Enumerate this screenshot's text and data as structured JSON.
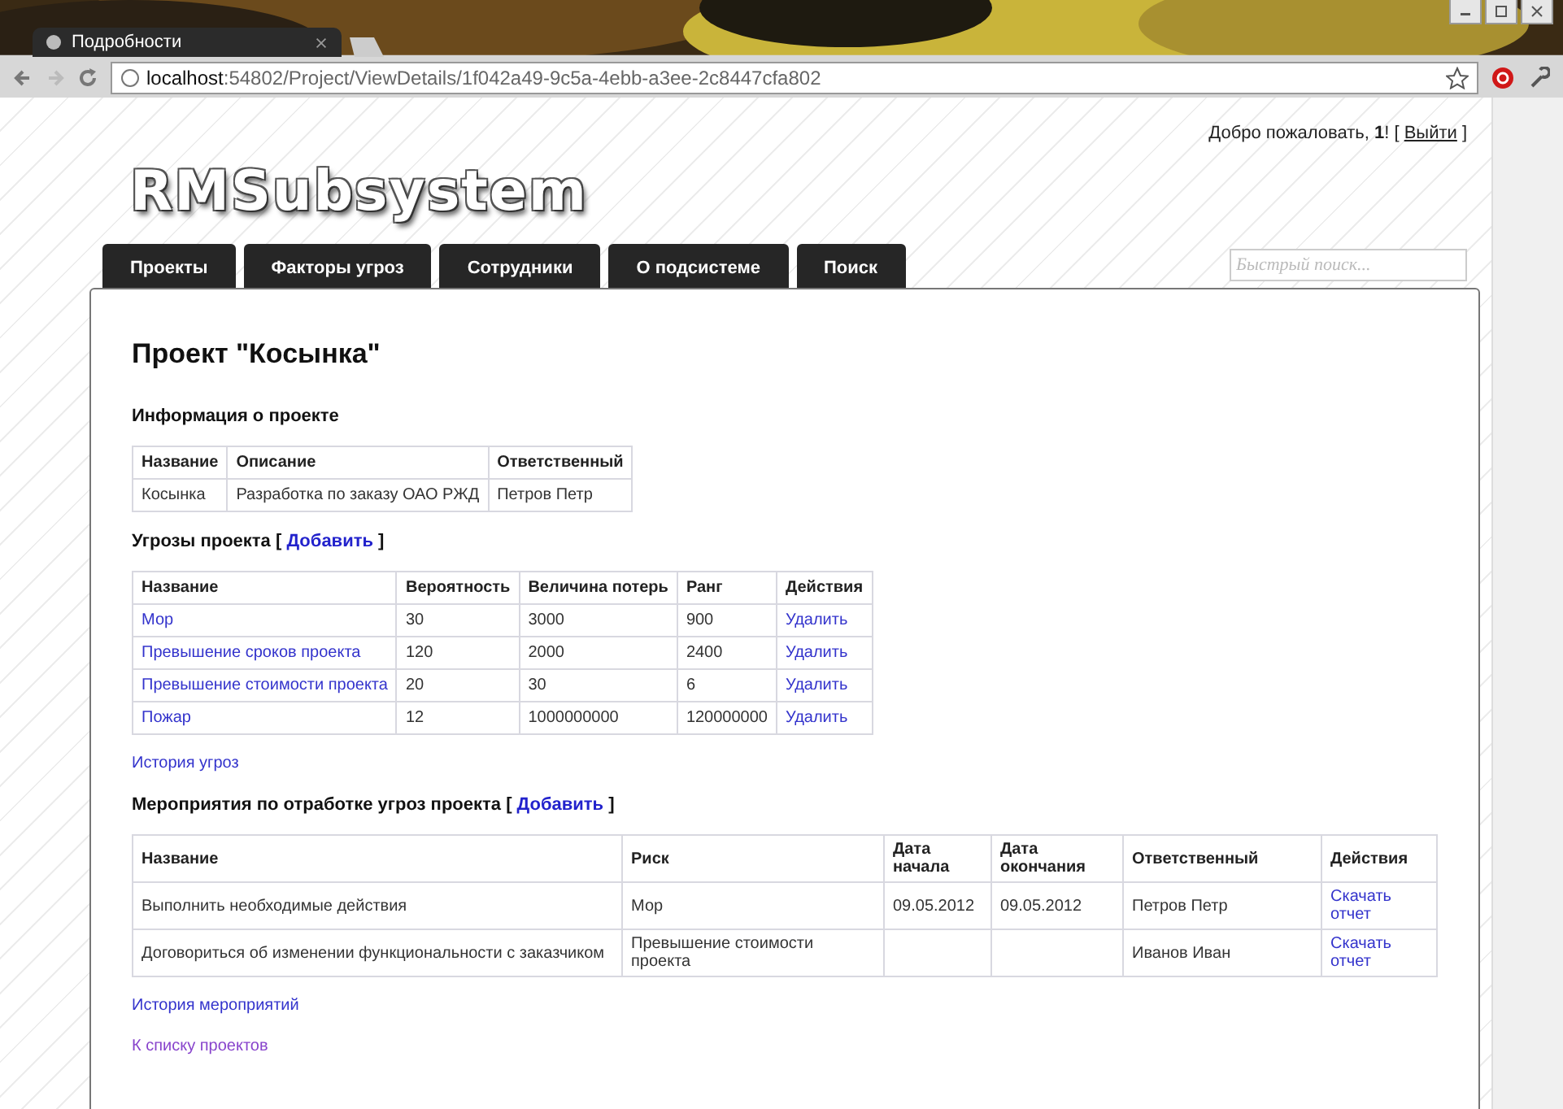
{
  "browser": {
    "tab_title": "Подробности",
    "url_host": "localhost",
    "url_path": ":54802/Project/ViewDetails/1f042a49-9c5a-4ebb-a3ee-2c8447cfa802"
  },
  "header": {
    "welcome": "Добро пожаловать, **1**! [",
    "logout": "Выйти",
    "welcome_end": "]",
    "logo": "RMSubsystem",
    "nav": [
      {
        "label": "Проекты"
      },
      {
        "label": "Факторы угроз"
      },
      {
        "label": "Сотрудники"
      },
      {
        "label": "О подсистеме"
      },
      {
        "label": "Поиск"
      }
    ],
    "search": {
      "placeholder": "Быстрый поиск..."
    }
  },
  "title": "Проект \"Косынка\"",
  "sections": [
    {
      "heading": "Информация о проекте",
      "table": {
        "columns": [
          {
            "label": "Название",
            "kind": "text"
          },
          {
            "label": "Описание",
            "kind": "text"
          },
          {
            "label": "Ответственный",
            "kind": "text"
          }
        ],
        "rows": [
          [
            "Косынка",
            "Разработка по заказу ОАО РЖД",
            "Петров Петр"
          ]
        ]
      }
    },
    {
      "heading": "Угрозы проекта [",
      "add": "Добавить",
      "heading_end": "]",
      "table": {
        "columns": [
          {
            "label": "Название",
            "kind": "link"
          },
          {
            "label": "Вероятность",
            "kind": "text"
          },
          {
            "label": "Величина потерь",
            "kind": "text"
          },
          {
            "label": "Ранг",
            "kind": "text"
          },
          {
            "label": "Действия",
            "kind": "link"
          }
        ],
        "rows": [
          [
            "Мор",
            "30",
            "3000",
            "900",
            "Удалить"
          ],
          [
            "Превышение сроков проекта",
            "120",
            "2000",
            "2400",
            "Удалить"
          ],
          [
            "Превышение стоимости проекта",
            "20",
            "30",
            "6",
            "Удалить"
          ],
          [
            "Пожар",
            "12",
            "1000000000",
            "120000000",
            "Удалить"
          ]
        ]
      },
      "links": [
        "История угроз"
      ]
    },
    {
      "heading": "Мероприятия по отработке угроз проекта [",
      "add": "Добавить",
      "heading_end": "]",
      "table": {
        "columns": [
          {
            "label": "Название",
            "kind": "text"
          },
          {
            "label": "Риск",
            "kind": "text"
          },
          {
            "label": "Дата начала",
            "kind": "text"
          },
          {
            "label": "Дата окончания",
            "kind": "text"
          },
          {
            "label": "Ответственный",
            "kind": "text"
          },
          {
            "label": "Действия",
            "kind": "link"
          }
        ],
        "rows": [
          [
            "Выполнить необходимые действия",
            "Мор",
            "09.05.2012",
            "09.05.2012",
            "Петров Петр",
            "Скачать отчет"
          ],
          [
            "Договориться об изменении функциональности с заказчиком",
            "Превышение стоимости проекта",
            "",
            "",
            "Иванов Иван",
            "Скачать отчет"
          ]
        ]
      },
      "links": [
        "История мероприятий",
        "К списку проектов"
      ]
    }
  ]
}
